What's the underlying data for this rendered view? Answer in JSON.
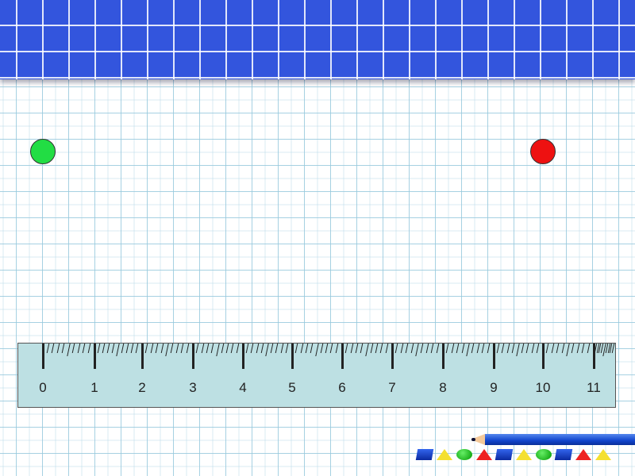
{
  "ruler": {
    "labels": [
      "0",
      "1",
      "2",
      "3",
      "4",
      "5",
      "6",
      "7",
      "8",
      "9",
      "10",
      "11"
    ]
  },
  "markers": [
    {
      "name": "start-point",
      "color": "#22dd44"
    },
    {
      "name": "end-point",
      "color": "#ee1111"
    }
  ],
  "decor": {
    "shapes": [
      "blue-cube",
      "yellow-triangle",
      "green-ball",
      "red-pyramid",
      "blue-cube",
      "yellow-triangle",
      "green-ball",
      "blue-cube",
      "red-pyramid",
      "yellow-triangle"
    ]
  }
}
